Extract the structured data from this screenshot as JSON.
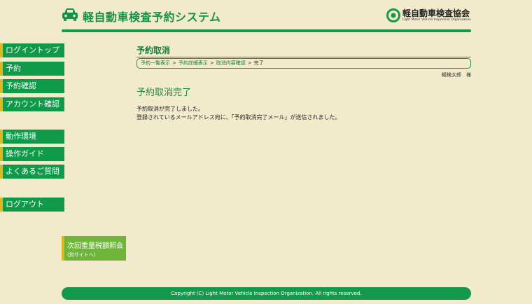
{
  "header": {
    "title": "軽自動車検査予約システム",
    "org_name": "軽自動車検査協会",
    "org_sub": "Light Motor Vehicle Inspection Organization"
  },
  "sidebar": {
    "items": [
      {
        "label": "ログイントップ"
      },
      {
        "label": "予約"
      },
      {
        "label": "予約確認"
      },
      {
        "label": "アカウント確認"
      },
      {
        "label": "動作環境"
      },
      {
        "label": "操作ガイド"
      },
      {
        "label": "よくあるご質問"
      },
      {
        "label": "ログアウト"
      }
    ],
    "external": {
      "label": "次回重量税額照会",
      "sub": "(別サイトへ)"
    }
  },
  "main": {
    "page_title": "予約取消",
    "breadcrumb": [
      "予約一覧表示",
      "予約詳細表示",
      "取消内容確認",
      "完了"
    ],
    "user_name": "軽検太郎　様",
    "complete_title": "予約取消完了",
    "messages": [
      "予約取消が完了しました。",
      "登録されているメールアドレス宛に、「予約取消完了メール」が送信されました。"
    ]
  },
  "footer": {
    "copyright": "Copyright (C) Light Motor Vehicle Inspection Organization. All rights reserved."
  },
  "colors": {
    "accent": "#15974d",
    "sidebar_marker": "#dcb71f",
    "background": "#f1ebcc",
    "external_nav": "#6fb53a"
  }
}
